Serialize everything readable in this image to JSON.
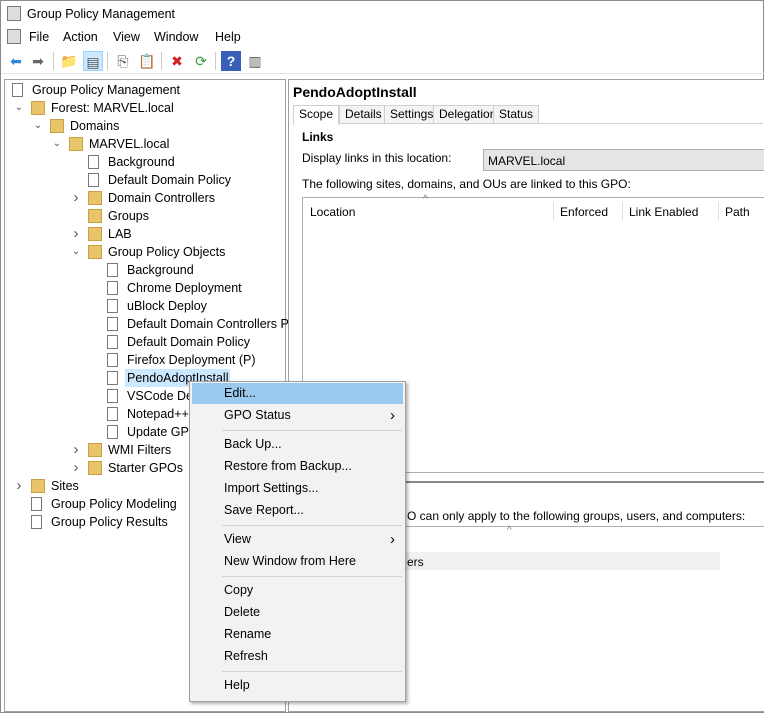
{
  "window": {
    "title": "Group Policy Management"
  },
  "menu": [
    "File",
    "Action",
    "View",
    "Window",
    "Help"
  ],
  "toolbar": [
    "back-icon",
    "forward-icon",
    "up-folder-icon",
    "show-hide-tree-icon",
    "copy-icon",
    "paste-icon",
    "delete-icon",
    "refresh-icon",
    "help-icon",
    "action-pane-icon"
  ],
  "tree": [
    {
      "label": "Group Policy Management",
      "level": 0,
      "icon": "gpm-icon"
    },
    {
      "label": "Forest: MARVEL.local",
      "level": 1,
      "icon": "forest-icon",
      "expanded": true
    },
    {
      "label": "Domains",
      "level": 2,
      "icon": "folder-icon",
      "expanded": true
    },
    {
      "label": "MARVEL.local",
      "level": 3,
      "icon": "domain-icon",
      "expanded": true
    },
    {
      "label": "Background",
      "level": 4,
      "icon": "gpo-link-icon"
    },
    {
      "label": "Default Domain Policy",
      "level": 4,
      "icon": "gpo-link-icon"
    },
    {
      "label": "Domain Controllers",
      "level": 4,
      "icon": "ou-icon",
      "expanded": false
    },
    {
      "label": "Groups",
      "level": 4,
      "icon": "ou-icon"
    },
    {
      "label": "LAB",
      "level": 4,
      "icon": "ou-icon",
      "expanded": false
    },
    {
      "label": "Group Policy Objects",
      "level": 4,
      "icon": "folder-icon",
      "expanded": true
    },
    {
      "label": "Background",
      "level": 5,
      "icon": "gpo-icon"
    },
    {
      "label": "Chrome Deployment",
      "level": 5,
      "icon": "gpo-icon"
    },
    {
      "label": "uBlock Deploy",
      "level": 5,
      "icon": "gpo-icon"
    },
    {
      "label": "Default Domain Controllers Po",
      "level": 5,
      "icon": "gpo-icon"
    },
    {
      "label": "Default Domain Policy",
      "level": 5,
      "icon": "gpo-icon"
    },
    {
      "label": "Firefox Deployment (P)",
      "level": 5,
      "icon": "gpo-icon"
    },
    {
      "label": "PendoAdoptInstall",
      "level": 5,
      "icon": "gpo-icon",
      "selected": true
    },
    {
      "label": "VSCode Dep",
      "level": 5,
      "icon": "gpo-icon"
    },
    {
      "label": "Notepad++",
      "level": 5,
      "icon": "gpo-icon"
    },
    {
      "label": "Update GPO",
      "level": 5,
      "icon": "gpo-icon"
    },
    {
      "label": "WMI Filters",
      "level": 4,
      "icon": "folder-icon",
      "expanded": false
    },
    {
      "label": "Starter GPOs",
      "level": 4,
      "icon": "folder-icon",
      "expanded": false
    },
    {
      "label": "Sites",
      "level": 1,
      "icon": "folder-icon",
      "expanded": false
    },
    {
      "label": "Group Policy Modeling",
      "level": 1,
      "icon": "modeling-icon"
    },
    {
      "label": "Group Policy Results",
      "level": 1,
      "icon": "results-icon"
    }
  ],
  "detail": {
    "title": "PendoAdoptInstall",
    "tabs": [
      "Scope",
      "Details",
      "Settings",
      "Delegation",
      "Status"
    ],
    "active_tab": "Scope",
    "links_heading": "Links",
    "display_label": "Display links in this location:",
    "display_value": "MARVEL.local",
    "linked_text": "The following sites, domains, and OUs are linked to this GPO:",
    "columns": [
      "Location",
      "Enforced",
      "Link Enabled",
      "Path"
    ],
    "security_text": "O can only apply to the following groups, users, and computers:",
    "security_row": "ers"
  },
  "context_menu": [
    {
      "label": "Edit...",
      "highlighted": true
    },
    {
      "label": "GPO Status",
      "submenu": true
    },
    {
      "sep": true
    },
    {
      "label": "Back Up..."
    },
    {
      "label": "Restore from Backup..."
    },
    {
      "label": "Import Settings..."
    },
    {
      "label": "Save Report..."
    },
    {
      "sep": true
    },
    {
      "label": "View",
      "submenu": true
    },
    {
      "label": "New Window from Here"
    },
    {
      "sep": true
    },
    {
      "label": "Copy"
    },
    {
      "label": "Delete"
    },
    {
      "label": "Rename"
    },
    {
      "label": "Refresh"
    },
    {
      "sep": true
    },
    {
      "label": "Help"
    }
  ],
  "colors": {
    "highlight": "#99c9ef",
    "selected": "#cce8ff",
    "menu_bg": "#f2f2f2"
  }
}
